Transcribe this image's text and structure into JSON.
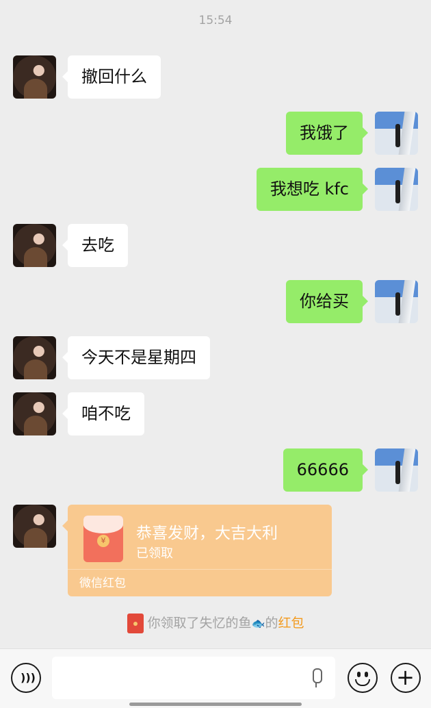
{
  "timestamp": "15:54",
  "messages": [
    {
      "side": "left",
      "text": "撤回什么"
    },
    {
      "side": "right",
      "text": "我饿了"
    },
    {
      "side": "right",
      "text": "我想吃 kfc"
    },
    {
      "side": "left",
      "text": "去吃"
    },
    {
      "side": "right",
      "text": "你给买"
    },
    {
      "side": "left",
      "text": "今天不是星期四"
    },
    {
      "side": "left",
      "text": "咱不吃"
    },
    {
      "side": "right",
      "text": "66666"
    }
  ],
  "red_packet": {
    "title": "恭喜发财，大吉大利",
    "status": "已领取",
    "footer": "微信红包",
    "coin": "¥"
  },
  "system_message": {
    "prefix": "你领取了失忆的鱼",
    "emoji": "🐟",
    "middle": "的",
    "link": "红包"
  },
  "input_bar": {
    "input_value": "",
    "voice_icon": "voice-icon",
    "emoji_icon": "emoji-icon",
    "plus_icon": "plus-icon"
  },
  "colors": {
    "background": "#ededed",
    "sent_bubble": "#95ec69",
    "received_bubble": "#ffffff",
    "red_packet": "#f9c98f",
    "link": "#f39a1d"
  }
}
